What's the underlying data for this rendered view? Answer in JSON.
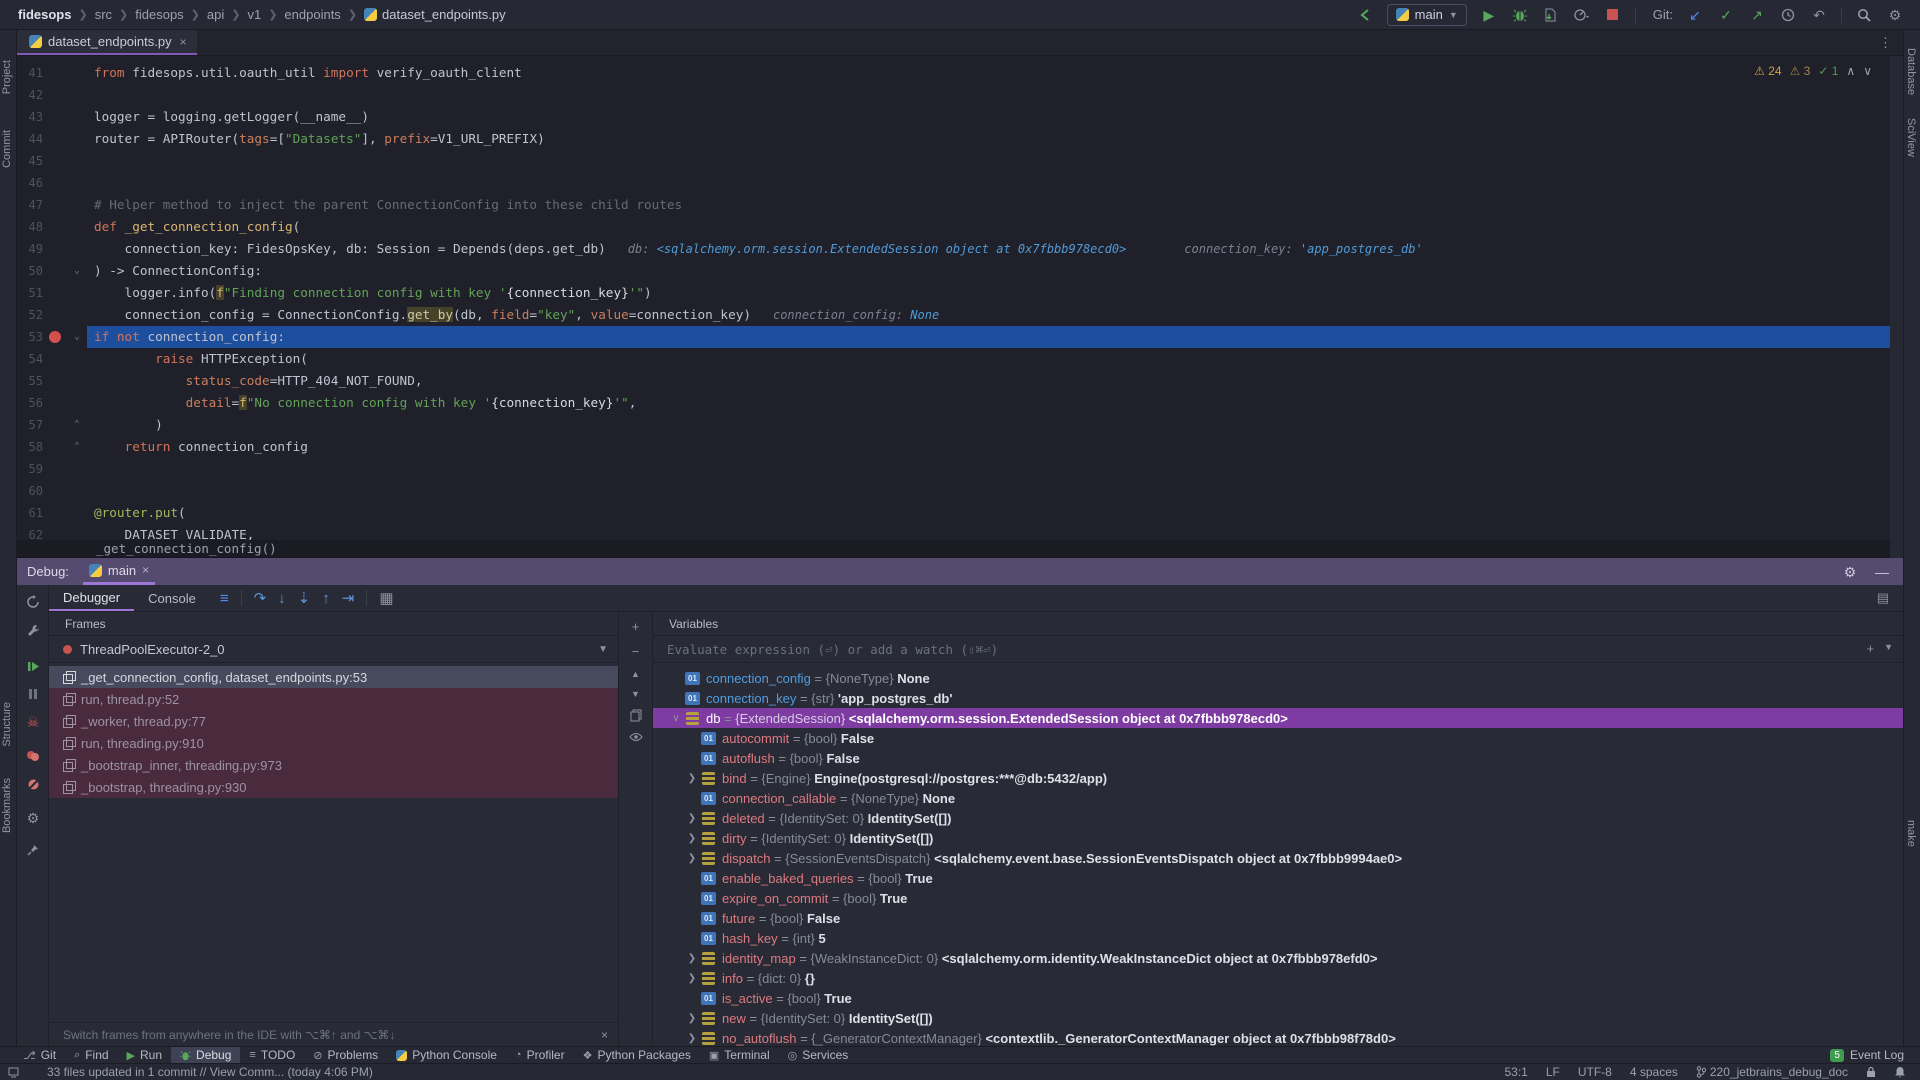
{
  "breadcrumbs": {
    "items": [
      "fidesops",
      "src",
      "fidesops",
      "api",
      "v1",
      "endpoints"
    ],
    "file": "dataset_endpoints.py"
  },
  "toolbar": {
    "run_config": "main",
    "git_label": "Git:"
  },
  "editor_tab": {
    "label": "dataset_endpoints.py"
  },
  "inspections": {
    "warnings": "24",
    "weak_warnings": "3",
    "ok": "1"
  },
  "editor": {
    "sticky_function": "_get_connection_config()",
    "lines": [
      {
        "n": 41,
        "segs": [
          [
            "k",
            "from"
          ],
          [
            "p",
            " fidesops.util.oauth_util "
          ],
          [
            "k",
            "import"
          ],
          [
            "p",
            " verify_oauth_client"
          ]
        ]
      },
      {
        "n": 42,
        "segs": []
      },
      {
        "n": 43,
        "segs": [
          [
            "p",
            "logger = logging.getLogger(__name__)"
          ]
        ]
      },
      {
        "n": 44,
        "segs": [
          [
            "p",
            "router = APIRouter("
          ],
          [
            "n",
            "tags"
          ],
          [
            "p",
            "=["
          ],
          [
            "s",
            "\"Datasets\""
          ],
          [
            "p",
            "], "
          ],
          [
            "n",
            "prefix"
          ],
          [
            "p",
            "=V1_URL_PREFIX)"
          ]
        ]
      },
      {
        "n": 45,
        "segs": []
      },
      {
        "n": 46,
        "segs": []
      },
      {
        "n": 47,
        "segs": [
          [
            "c",
            "# Helper method to inject the parent ConnectionConfig into these child routes"
          ]
        ]
      },
      {
        "n": 48,
        "segs": [
          [
            "k",
            "def"
          ],
          [
            "p",
            " "
          ],
          [
            "fn",
            "_get_connection_config"
          ],
          [
            "p",
            "("
          ]
        ]
      },
      {
        "n": 49,
        "segs": [
          [
            "p",
            "    connection_key: FidesOpsKey, db: Session = Depends(deps.get_db)"
          ]
        ],
        "hints": [
          {
            "label": "db: ",
            "value": "<sqlalchemy.orm.session.ExtendedSession object at 0x7fbbb978ecd0>",
            "gap": 22
          },
          {
            "label": "connection_key: ",
            "value": "'app_postgres_db'",
            "gap": 58
          }
        ]
      },
      {
        "n": 50,
        "segs": [
          [
            "p",
            ") -> ConnectionConfig:"
          ]
        ],
        "fold": "v"
      },
      {
        "n": 51,
        "segs": [
          [
            "p",
            "    logger.info("
          ],
          [
            "f",
            "f"
          ],
          [
            "s",
            "\"Finding connection config with key '"
          ],
          [
            "i",
            "{connection_key}"
          ],
          [
            "s",
            "'\""
          ],
          [
            "p",
            ")"
          ]
        ]
      },
      {
        "n": 52,
        "segs": [
          [
            "p",
            "    connection_config = ConnectionConfig."
          ],
          [
            "g",
            "get_by"
          ],
          [
            "p",
            "(db, "
          ],
          [
            "n",
            "field"
          ],
          [
            "p",
            "="
          ],
          [
            "s",
            "\"key\""
          ],
          [
            "p",
            ", "
          ],
          [
            "n",
            "value"
          ],
          [
            "p",
            "=connection_key)"
          ]
        ],
        "hints": [
          {
            "label": "connection_config: ",
            "value": "None",
            "gap": 22
          }
        ]
      },
      {
        "n": 53,
        "segs": [
          [
            "k",
            "if"
          ],
          [
            "p",
            " "
          ],
          [
            "k",
            "not"
          ],
          [
            "p",
            " connection_config:"
          ]
        ],
        "bp": true,
        "cur": true,
        "fold": "v"
      },
      {
        "n": 54,
        "segs": [
          [
            "p",
            "        "
          ],
          [
            "k",
            "raise"
          ],
          [
            "p",
            " HTTPException("
          ]
        ]
      },
      {
        "n": 55,
        "segs": [
          [
            "p",
            "            "
          ],
          [
            "n",
            "status_code"
          ],
          [
            "p",
            "=HTTP_404_NOT_FOUND,"
          ]
        ]
      },
      {
        "n": 56,
        "segs": [
          [
            "p",
            "            "
          ],
          [
            "n",
            "detail"
          ],
          [
            "p",
            "="
          ],
          [
            "f",
            "f"
          ],
          [
            "s",
            "\"No connection config with key '"
          ],
          [
            "i",
            "{connection_key}"
          ],
          [
            "s",
            "'\""
          ],
          [
            "p",
            ","
          ]
        ]
      },
      {
        "n": 57,
        "segs": [
          [
            "p",
            "        )"
          ]
        ],
        "fold": "^"
      },
      {
        "n": 58,
        "segs": [
          [
            "p",
            "    "
          ],
          [
            "k",
            "return"
          ],
          [
            "p",
            " connection_config"
          ]
        ],
        "fold": "^"
      },
      {
        "n": 59,
        "segs": []
      },
      {
        "n": 60,
        "segs": []
      },
      {
        "n": 61,
        "segs": [
          [
            "d",
            "@router.put"
          ],
          [
            "p",
            "("
          ]
        ]
      },
      {
        "n": 62,
        "segs": [
          [
            "p",
            "    DATASET_VALIDATE,"
          ]
        ]
      }
    ]
  },
  "debug": {
    "title": "Debug:",
    "session_tab": "main",
    "tabs": [
      "Debugger",
      "Console"
    ],
    "frames": {
      "header": "Frames",
      "thread": "ThreadPoolExecutor-2_0",
      "items": [
        {
          "label": "_get_connection_config, dataset_endpoints.py:53",
          "state": "current"
        },
        {
          "label": "run, thread.py:52",
          "state": "lib"
        },
        {
          "label": "_worker, thread.py:77",
          "state": "lib"
        },
        {
          "label": "run, threading.py:910",
          "state": "lib"
        },
        {
          "label": "_bootstrap_inner, threading.py:973",
          "state": "lib"
        },
        {
          "label": "_bootstrap, threading.py:930",
          "state": "lib"
        }
      ],
      "hint": "Switch frames from anywhere in the IDE with ⌥⌘↑ and ⌥⌘↓"
    },
    "variables": {
      "header": "Variables",
      "evaluate_placeholder": "Evaluate expression (⏎) or add a watch (⇧⌘⏎)",
      "items": [
        {
          "name": "connection_config",
          "type": "{NoneType}",
          "value": "None",
          "icon": "prim",
          "level": 0
        },
        {
          "name": "connection_key",
          "type": "{str}",
          "value": "'app_postgres_db'",
          "icon": "prim",
          "level": 0
        },
        {
          "name": "db",
          "type": "{ExtendedSession}",
          "value": "<sqlalchemy.orm.session.ExtendedSession object at 0x7fbbb978ecd0>",
          "icon": "obj",
          "level": 0,
          "expanded": true,
          "selected": true
        },
        {
          "name": "autocommit",
          "type": "{bool}",
          "value": "False",
          "icon": "prim",
          "level": 1
        },
        {
          "name": "autoflush",
          "type": "{bool}",
          "value": "False",
          "icon": "prim",
          "level": 1
        },
        {
          "name": "bind",
          "type": "{Engine}",
          "value": "Engine(postgresql://postgres:***@db:5432/app)",
          "icon": "obj",
          "level": 1,
          "expandable": true
        },
        {
          "name": "connection_callable",
          "type": "{NoneType}",
          "value": "None",
          "icon": "prim",
          "level": 1
        },
        {
          "name": "deleted",
          "type": "{IdentitySet: 0}",
          "value": "IdentitySet([])",
          "icon": "obj",
          "level": 1,
          "expandable": true
        },
        {
          "name": "dirty",
          "type": "{IdentitySet: 0}",
          "value": "IdentitySet([])",
          "icon": "obj",
          "level": 1,
          "expandable": true
        },
        {
          "name": "dispatch",
          "type": "{SessionEventsDispatch}",
          "value": "<sqlalchemy.event.base.SessionEventsDispatch object at 0x7fbbb9994ae0>",
          "icon": "obj",
          "level": 1,
          "expandable": true
        },
        {
          "name": "enable_baked_queries",
          "type": "{bool}",
          "value": "True",
          "icon": "prim",
          "level": 1
        },
        {
          "name": "expire_on_commit",
          "type": "{bool}",
          "value": "True",
          "icon": "prim",
          "level": 1
        },
        {
          "name": "future",
          "type": "{bool}",
          "value": "False",
          "icon": "prim",
          "level": 1
        },
        {
          "name": "hash_key",
          "type": "{int}",
          "value": "5",
          "icon": "prim",
          "level": 1
        },
        {
          "name": "identity_map",
          "type": "{WeakInstanceDict: 0}",
          "value": "<sqlalchemy.orm.identity.WeakInstanceDict object at 0x7fbbb978efd0>",
          "icon": "obj",
          "level": 1,
          "expandable": true
        },
        {
          "name": "info",
          "type": "{dict: 0}",
          "value": "{}",
          "icon": "obj",
          "level": 1,
          "expandable": true
        },
        {
          "name": "is_active",
          "type": "{bool}",
          "value": "True",
          "icon": "prim",
          "level": 1
        },
        {
          "name": "new",
          "type": "{IdentitySet: 0}",
          "value": "IdentitySet([])",
          "icon": "obj",
          "level": 1,
          "expandable": true
        },
        {
          "name": "no_autoflush",
          "type": "{_GeneratorContextManager}",
          "value": "<contextlib._GeneratorContextManager object at 0x7fbbb98f78d0>",
          "icon": "obj",
          "level": 1,
          "expandable": true
        }
      ]
    }
  },
  "bottom_bar": {
    "items": [
      "Git",
      "Find",
      "Run",
      "Debug",
      "TODO",
      "Problems",
      "Python Console",
      "Profiler",
      "Python Packages",
      "Terminal",
      "Services"
    ],
    "active": "Debug",
    "event_log": {
      "count": "5",
      "label": "Event Log"
    }
  },
  "status_bar": {
    "message": "33 files updated in 1 commit // View Comm... (today 4:06 PM)",
    "position": "53:1",
    "line_ending": "LF",
    "encoding": "UTF-8",
    "indent": "4 spaces",
    "branch": "220_jetbrains_debug_doc"
  },
  "side_strips": {
    "left": [
      "Project",
      "Commit",
      "Structure",
      "Bookmarks"
    ],
    "right": [
      "Database",
      "SciView",
      "make"
    ]
  }
}
